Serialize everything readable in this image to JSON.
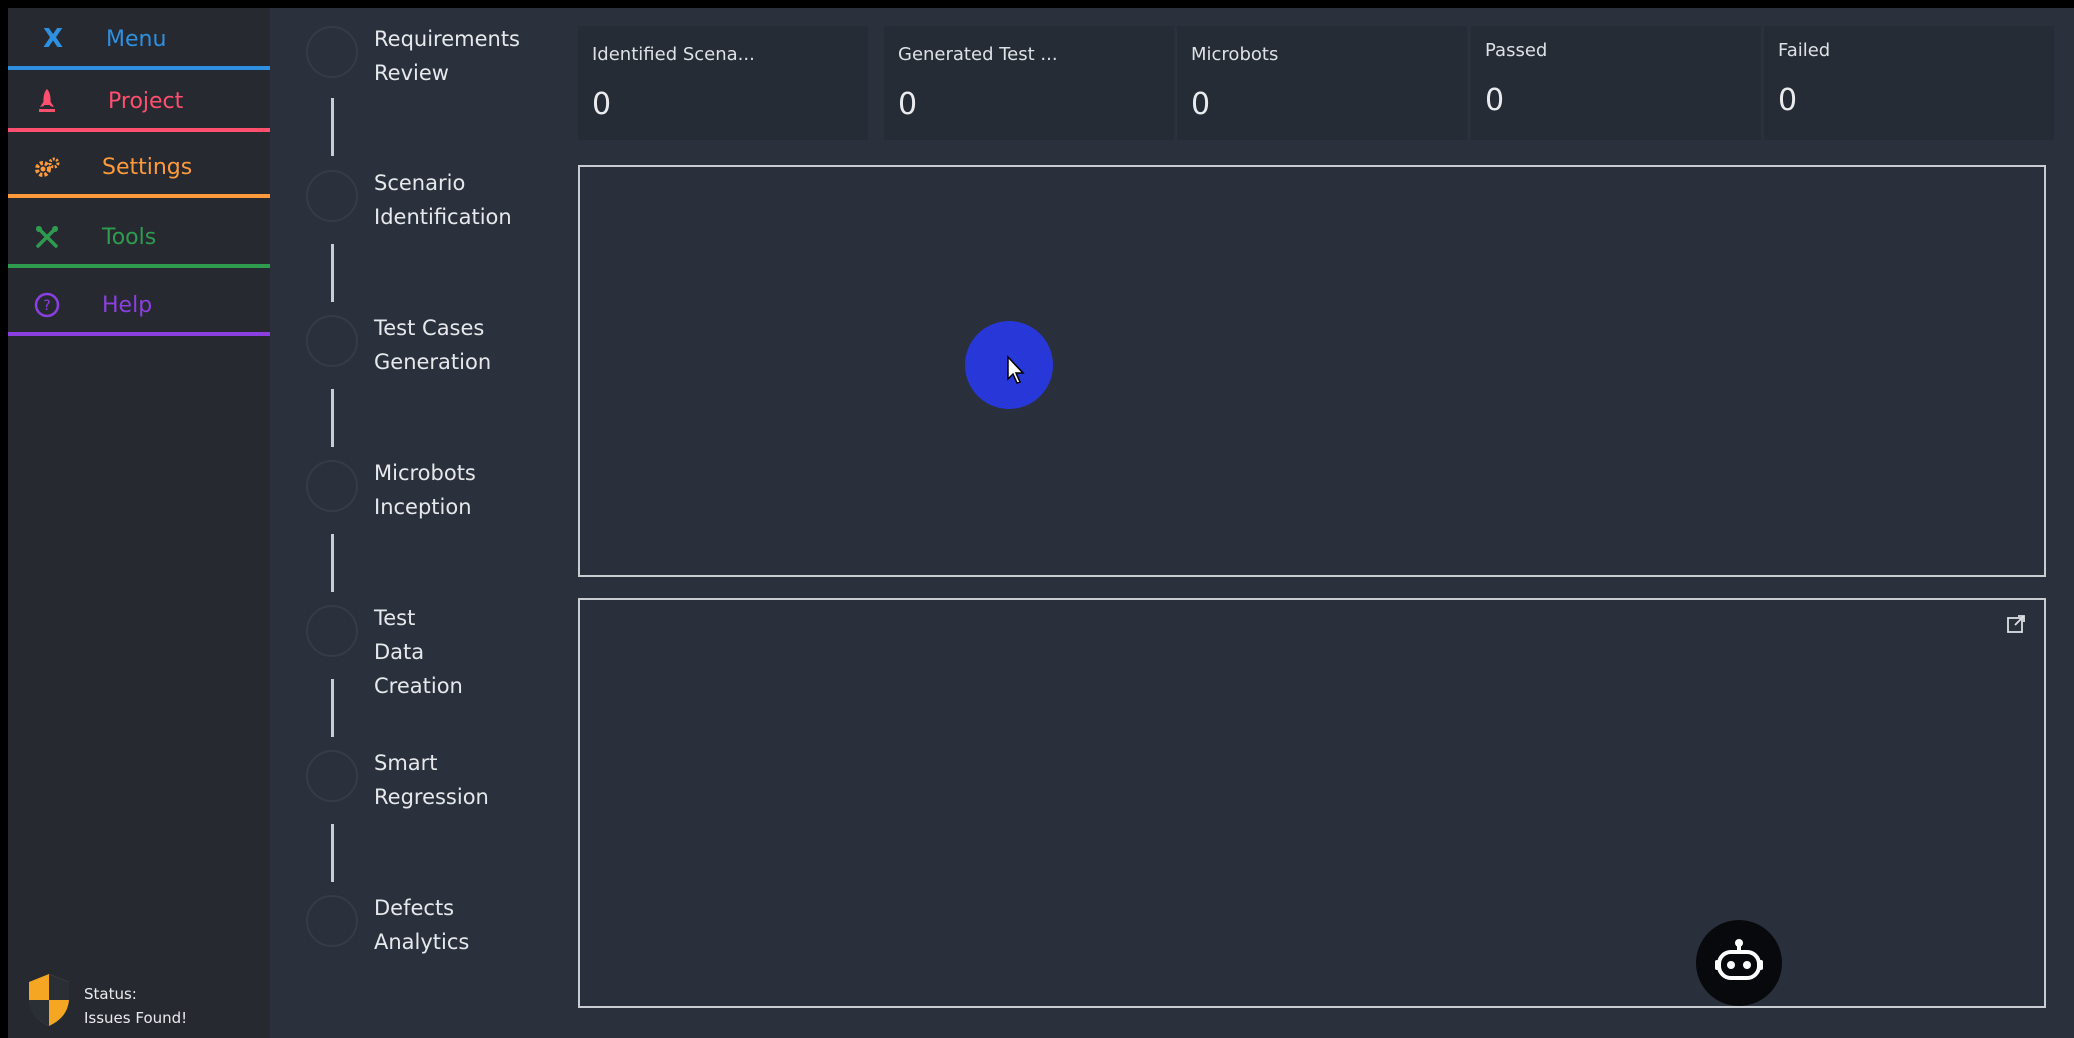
{
  "sidebar": {
    "menu": {
      "close_glyph": "X",
      "label": "Menu",
      "color": "#2f8fe0",
      "icon": "close-icon"
    },
    "items": [
      {
        "label": "Project",
        "color": "#ff4f6e",
        "icon": "rocket-icon"
      },
      {
        "label": "Settings",
        "color": "#ff9a3c",
        "icon": "gears-icon"
      },
      {
        "label": "Tools",
        "color": "#2f9b4e",
        "icon": "tools-icon"
      },
      {
        "label": "Help",
        "color": "#8b3fe0",
        "icon": "help-icon"
      }
    ],
    "status": {
      "label": "Status:",
      "value": "Issues Found!",
      "icon": "shield-icon",
      "color": "#f5a623"
    }
  },
  "steps": [
    {
      "label": "Requirements\nReview"
    },
    {
      "label": "Scenario\nIdentification"
    },
    {
      "label": "Test Cases\nGeneration"
    },
    {
      "label": "Microbots\nInception"
    },
    {
      "label": "Test\nData\nCreation"
    },
    {
      "label": "Smart\nRegression"
    },
    {
      "label": "Defects\nAnalytics"
    }
  ],
  "stats": [
    {
      "title": "Identified Scena...",
      "value": "0"
    },
    {
      "title": "Generated Test ...",
      "value": "0"
    },
    {
      "title": "Microbots",
      "value": "0"
    },
    {
      "title": "Passed",
      "value": "0"
    },
    {
      "title": "Failed",
      "value": "0"
    }
  ],
  "panels": {
    "expand_icon": "external-link-icon"
  },
  "chatbot": {
    "icon": "robot-icon"
  },
  "colors": {
    "main_bg": "#2a313d",
    "sidebar_bg": "#262a30",
    "cursor_highlight": "#2838d8"
  }
}
